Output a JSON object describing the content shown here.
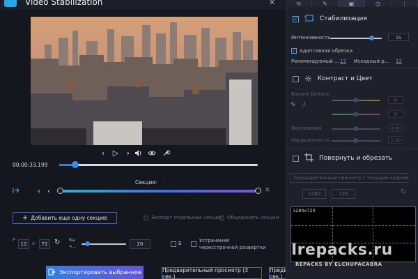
{
  "app": {
    "title": "Video Stabilization",
    "close": "✕"
  },
  "player": {
    "time": "00:00:33.199",
    "progress": 0.08,
    "controls": [
      "‹",
      "▷",
      "›"
    ]
  },
  "section": {
    "label": "Секция:",
    "add_button": "Добавить еще одну секцию",
    "export_separate": "Экспорт отдельных секций",
    "merge_sections": "Объединить секции"
  },
  "params": {
    "p_label": "P",
    "w": "12",
    "x_sep": "x",
    "h": "72",
    "k_label": "Ка ч...",
    "slider_value": "20",
    "b_label": "Б",
    "deinterlace": "Устранение чересстрочной развертки",
    "slider_pos": 0.12
  },
  "bottom": {
    "export": "Экспортировать выбранное",
    "preview3": "Предварительный просмотр (3 сек.)",
    "preview10": "Предварительный просмотр (10 сек.)"
  },
  "panel": {
    "stab": {
      "title": "Стабилизация",
      "intensity_label": "Интенсивность",
      "intensity_value": "15",
      "intensity_pos": 0.8,
      "adaptive": "Адаптивная обрезка",
      "recommended": "Рекомендуемый ...",
      "recommended_value": "12",
      "source": "Исходный р...",
      "source_value": "12"
    },
    "contrast": {
      "title": "Контраст и Цвет",
      "white_balance": "Баланс белого",
      "wb1": "0",
      "wb2": "0",
      "exposure": "Экспозиция",
      "exposure_value": "0,00",
      "saturation": "Насыщенность",
      "saturation_value": "1,00"
    },
    "rotate": {
      "title": "Повернуть и обрезать",
      "preview_placeholder": "Предварительный просмотр с текущим кадром",
      "w": "1280",
      "h": "720",
      "grid_label": "1280x720"
    }
  },
  "watermark": {
    "line1": "Irepacks.ru",
    "line2": "REPACKS BY ELCHUPACABRA"
  }
}
